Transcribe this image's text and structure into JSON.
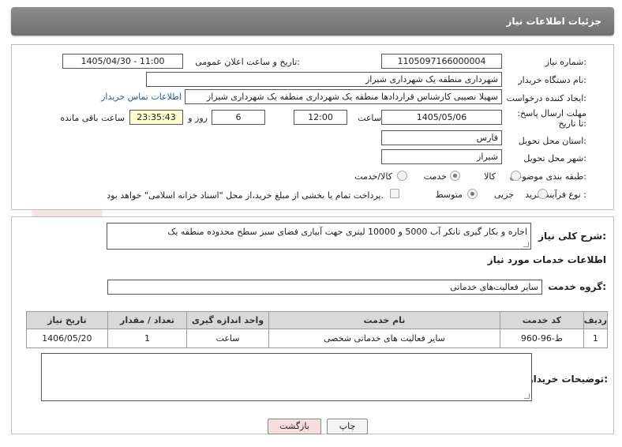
{
  "header": {
    "title": "جزئیات اطلاعات نیاز"
  },
  "form": {
    "need_number_label": "شماره نیاز:",
    "need_number": "1105097166000004",
    "announce_label": "تاریخ و ساعت اعلان عمومی:",
    "announce_value": "1405/04/30 - 11:00",
    "buyer_org_label": "نام دستگاه خریدار:",
    "buyer_org": "شهرداری منطقه یک شهرداری شیراز",
    "creator_label": "ایجاد کننده درخواست:",
    "creator": "سهیلا نصیبی کارشناس قراردادها منطقه یک شهرداری منطقه یک شهرداری شیراز",
    "buyer_contact_link": "اطلاعات تماس خریدار",
    "deadline_label": "مهلت ارسال پاسخ: تا تاریخ:",
    "deadline_date": "1405/05/06",
    "time_label": "ساعت",
    "deadline_time": "12:00",
    "days_value": "6",
    "days_label": "روز و",
    "remaining_time": "23:35:43",
    "remaining_label": "ساعت باقی مانده",
    "province_label": "استان محل تحویل:",
    "province": "فارس",
    "city_label": "شهر محل تحویل:",
    "city": "شیراز",
    "category_label": "طبقه بندی موضوعی:",
    "category_options": [
      "کالا",
      "خدمت",
      "کالا/خدمت"
    ],
    "category_selected": "خدمت",
    "process_label": "نوع فرآیند خرید :",
    "process_options": [
      "جزیی",
      "متوسط"
    ],
    "process_selected": "متوسط",
    "payment_note": "پرداخت تمام یا بخشی از مبلغ خرید،از محل \"اسناد خزانه اسلامی\" خواهد بود."
  },
  "description": {
    "label": "شرح کلی نیاز:",
    "text": "اجاره و بکار گیری تانکر آب 5000 و 10000 لیتری جهت آبیاری فضای سبز سطح محدوده منطقه یک"
  },
  "services": {
    "section_title": "اطلاعات خدمات مورد نیاز",
    "group_label": "گروه خدمت:",
    "group_value": "سایر فعالیت‌های خدماتی",
    "columns": [
      "ردیف",
      "کد خدمت",
      "نام خدمت",
      "واحد اندازه گیری",
      "تعداد / مقدار",
      "تاریخ نیاز"
    ],
    "rows": [
      [
        "1",
        "ط-96-960",
        "سایر فعالیت های خدماتی شخصی",
        "ساعت",
        "1",
        "1406/05/20"
      ]
    ]
  },
  "buyer_notes": {
    "label": "توضیحات خریدار:",
    "text": ""
  },
  "buttons": {
    "print": "چاپ",
    "back": "بازگشت"
  },
  "watermark": {
    "text": "AriaTender.net",
    "color": "#c0392b"
  }
}
